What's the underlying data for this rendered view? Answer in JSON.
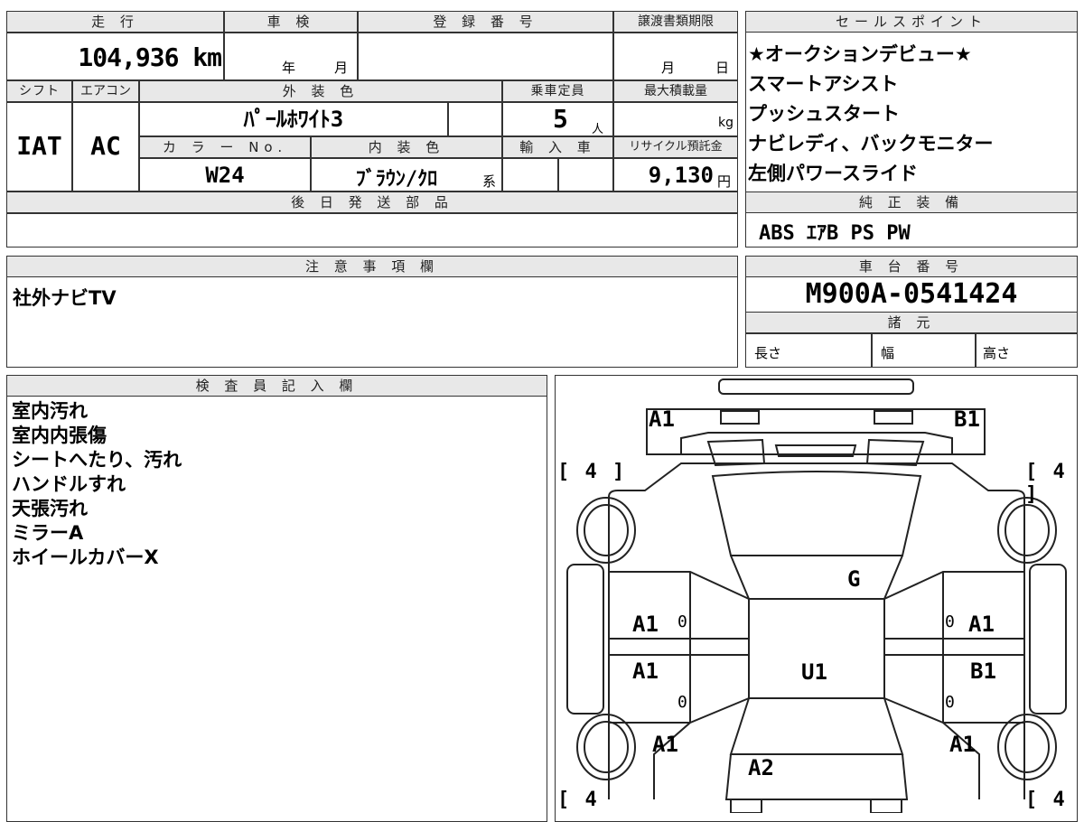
{
  "basic": {
    "mileage_label": "走 行",
    "mileage": "104,936 km",
    "inspection_label": "車 検",
    "inspection_year": "年",
    "inspection_month": "月",
    "registration_label": "登 録 番 号",
    "transfer_label": "譲渡書類期限",
    "transfer_month": "月",
    "transfer_day": "日",
    "shift_label": "シフト",
    "shift": "IAT",
    "ac_label": "エアコン",
    "ac": "AC",
    "exterior_label": "外 装 色",
    "exterior": "ﾊﾟｰﾙﾎﾜｲﾄ3",
    "capacity_label": "乗車定員",
    "capacity": "5",
    "capacity_unit": "人",
    "load_label": "最大積載量",
    "load_unit": "kg",
    "color_no_label": "カ ラ ー No.",
    "color_no": "W24",
    "interior_label": "内 装 色",
    "interior": "ﾌﾞﾗｳﾝ/ｸﾛ",
    "interior_suffix": "系",
    "import_label": "輸 入 車",
    "recycle_label": "リサイクル預託金",
    "recycle": "9,130",
    "recycle_unit": "円",
    "later_parts_label": "後 日 発 送 部 品"
  },
  "sales": {
    "label": "セールスポイント",
    "lines": [
      "★オークションデビュー★",
      "スマートアシスト",
      "プッシュスタート",
      "ナビレディ、バックモニター",
      "左側パワースライド"
    ]
  },
  "equipment": {
    "label": "純 正 装 備",
    "value": "ABS ｴｱB PS PW"
  },
  "notes": {
    "label": "注 意 事 項 欄",
    "value": "社外ナビTV"
  },
  "chassis": {
    "label": "車 台 番 号",
    "value": "M900A-0541424",
    "specs_label": "諸 元",
    "length": "長さ",
    "width": "幅",
    "height": "高さ"
  },
  "inspector": {
    "label": "検 査 員 記 入 欄",
    "lines": [
      "室内汚れ",
      "室内内張傷",
      "シートへたり、汚れ",
      "ハンドルすれ",
      "天張汚れ",
      "ミラーA",
      "ホイールカバーX"
    ]
  },
  "diagram": {
    "tire_tl": "[ 4 ]",
    "tire_tr": "[ 4 ]",
    "tire_bl": "[ 4",
    "tire_br": "[ 4",
    "front_left": "A1",
    "front_right": "B1",
    "windshield": "G",
    "roof": "U1",
    "door_fl": "A1",
    "door_fr": "A1",
    "door_rl": "A1",
    "door_rr": "B1",
    "zero_1": "0",
    "zero_2": "0",
    "zero_3": "0",
    "zero_4": "0",
    "quarter_l": "A1",
    "quarter_r": "A1",
    "rear": "A2"
  }
}
